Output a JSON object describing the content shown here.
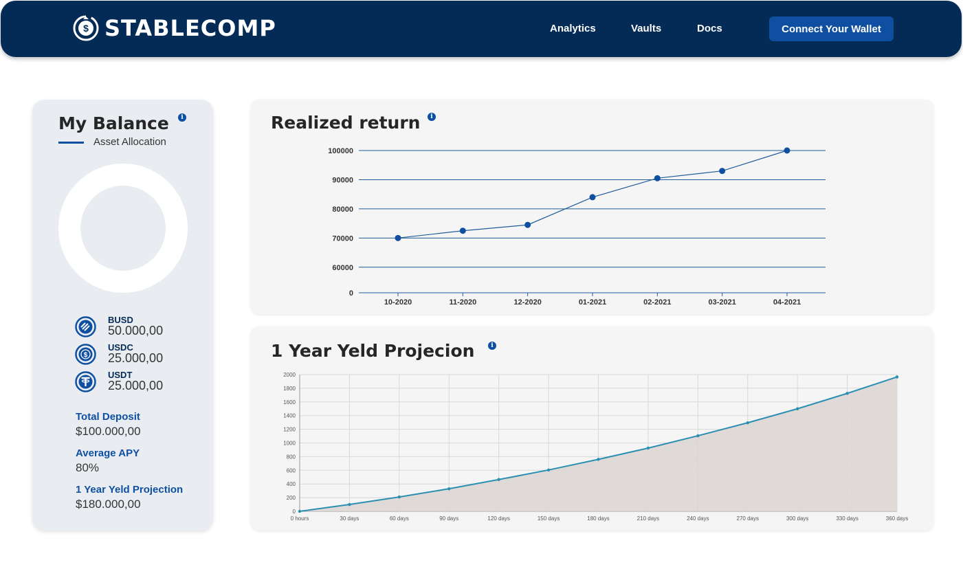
{
  "header": {
    "brand": "STABLECOMP",
    "nav": [
      "Analytics",
      "Vaults",
      "Docs"
    ],
    "connect_label": "Connect Your Wallet"
  },
  "colors": {
    "navy": "#032b56",
    "accent": "#0f4fa1",
    "teal": "#2a8fb0",
    "area_fill": "#ddd6d4"
  },
  "balance": {
    "title": "My Balance",
    "subtitle": "Asset Allocation",
    "assets": [
      {
        "name": "BUSD",
        "amount": "50.000,00",
        "icon": "busd-icon"
      },
      {
        "name": "USDC",
        "amount": "25.000,00",
        "icon": "usdc-icon"
      },
      {
        "name": "USDT",
        "amount": "25.000,00",
        "icon": "usdt-icon"
      }
    ],
    "stats": [
      {
        "label": "Total Deposit",
        "value": "$100.000,00"
      },
      {
        "label": "Average APY",
        "value": "80%"
      },
      {
        "label": "1 Year Yeld Projection",
        "value": "$180.000,00"
      }
    ]
  },
  "chart_data": [
    {
      "type": "line",
      "title": "Realized return",
      "categories": [
        "10-2020",
        "11-2020",
        "12-2020",
        "01-2021",
        "02-2021",
        "03-2021",
        "04-2021"
      ],
      "values": [
        70000,
        72500,
        74500,
        84000,
        90500,
        93000,
        100000
      ],
      "y_ticks": [
        0,
        60000,
        70000,
        80000,
        90000,
        100000
      ],
      "ylim": [
        55000,
        100000
      ],
      "grid": true
    },
    {
      "type": "area",
      "title": "1 Year Yeld Projecion",
      "categories": [
        "0 hours",
        "30 days",
        "60 days",
        "90 days",
        "120 days",
        "150 days",
        "180 days",
        "210 days",
        "240 days",
        "270 days",
        "300 days",
        "330 days",
        "360 days"
      ],
      "values": [
        0,
        100,
        210,
        330,
        465,
        605,
        760,
        925,
        1105,
        1295,
        1500,
        1725,
        1965
      ],
      "y_ticks": [
        0,
        200,
        400,
        600,
        800,
        1000,
        1200,
        1400,
        1600,
        1800,
        2000
      ],
      "ylim": [
        0,
        2000
      ],
      "grid": true
    }
  ]
}
